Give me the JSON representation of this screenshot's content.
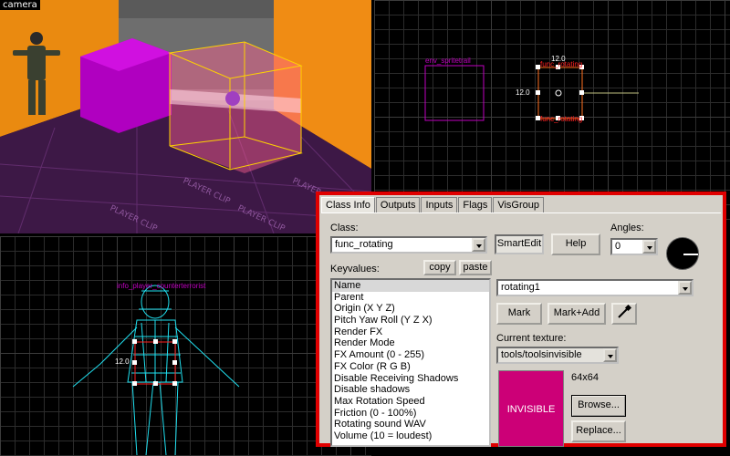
{
  "viewports": {
    "camera": {
      "label": "camera"
    },
    "top": {
      "entity_label": "env_spritetrail",
      "box_label_top": "func_rotating",
      "box_label_bottom": "func_rotating",
      "dim_top": "12.0",
      "dim_left": "12.0"
    },
    "side": {
      "entity_label": "info_player_counterterrorist",
      "dim_left": "12.0"
    }
  },
  "dialog": {
    "tabs": [
      {
        "label": "Class Info"
      },
      {
        "label": "Outputs"
      },
      {
        "label": "Inputs"
      },
      {
        "label": "Flags"
      },
      {
        "label": "VisGroup"
      }
    ],
    "class_label": "Class:",
    "class_value": "func_rotating",
    "smartedit_label": "SmartEdit",
    "help_label": "Help",
    "angles_label": "Angles:",
    "angles_value": "0",
    "keyvalues_label": "Keyvalues:",
    "copy_label": "copy",
    "paste_label": "paste",
    "keyvalues": [
      "Name",
      "Parent",
      "Origin (X Y Z)",
      "Pitch Yaw Roll (Y Z X)",
      "Render FX",
      "Render Mode",
      "FX Amount (0 - 255)",
      "FX Color (R G B)",
      "Disable Receiving Shadows",
      "Disable shadows",
      "Max Rotation Speed",
      "Friction (0 - 100%)",
      "Rotating sound WAV",
      "Volume (10 = loudest)"
    ],
    "value_field": "rotating1",
    "mark_label": "Mark",
    "mark_add_label": "Mark+Add",
    "current_texture_label": "Current texture:",
    "texture_value": "tools/toolsinvisible",
    "texture_size": "64x64",
    "texture_preview_text": "INVISIBLE",
    "browse_label": "Browse...",
    "replace_label": "Replace..."
  },
  "colors": {
    "dialog_border": "#e00000",
    "texture_swatch": "#cc0077",
    "entity_magenta": "#c000c0",
    "selection_red": "#ff2020",
    "wireframe_cyan": "#20e0f0"
  }
}
